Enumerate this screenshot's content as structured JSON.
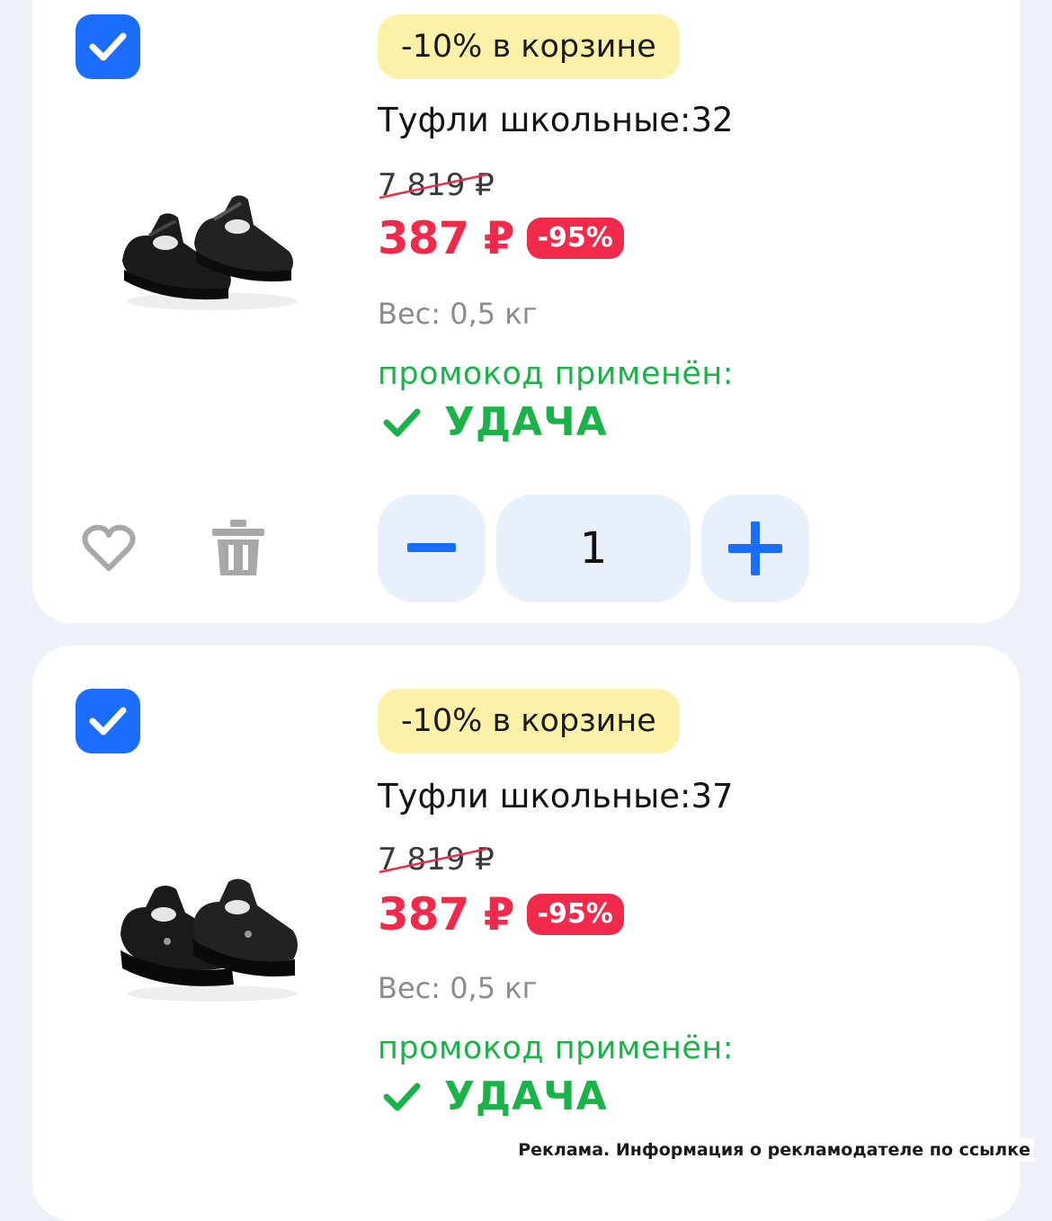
{
  "cart_items": [
    {
      "checked": true,
      "promo_badge": "-10% в корзине",
      "title": "Туфли школьные:32",
      "old_price": "7 819 ₽",
      "price": "387 ₽",
      "discount": "-95%",
      "weight": "Вес: 0,5 кг",
      "promo_applied_label": "промокод применён:",
      "promo_code": "УДАЧА",
      "quantity": "1"
    },
    {
      "checked": true,
      "promo_badge": "-10% в корзине",
      "title": "Туфли школьные:37",
      "old_price": "7 819 ₽",
      "price": "387 ₽",
      "discount": "-95%",
      "weight": "Вес: 0,5 кг",
      "promo_applied_label": "промокод применён:",
      "promo_code": "УДАЧА",
      "quantity": ""
    }
  ],
  "ad_notice": "Реклама. Информация о рекламодателе по ссылке",
  "colors": {
    "accent_blue": "#1a6dff",
    "price_red": "#f12a4b",
    "promo_green": "#1cb24a",
    "badge_yellow": "#fbf1a9",
    "stepper_bg": "#e8f0fc"
  },
  "icons": [
    "checkbox-checked-icon",
    "heart-icon",
    "trash-icon",
    "minus-icon",
    "plus-icon",
    "checkmark-icon"
  ]
}
